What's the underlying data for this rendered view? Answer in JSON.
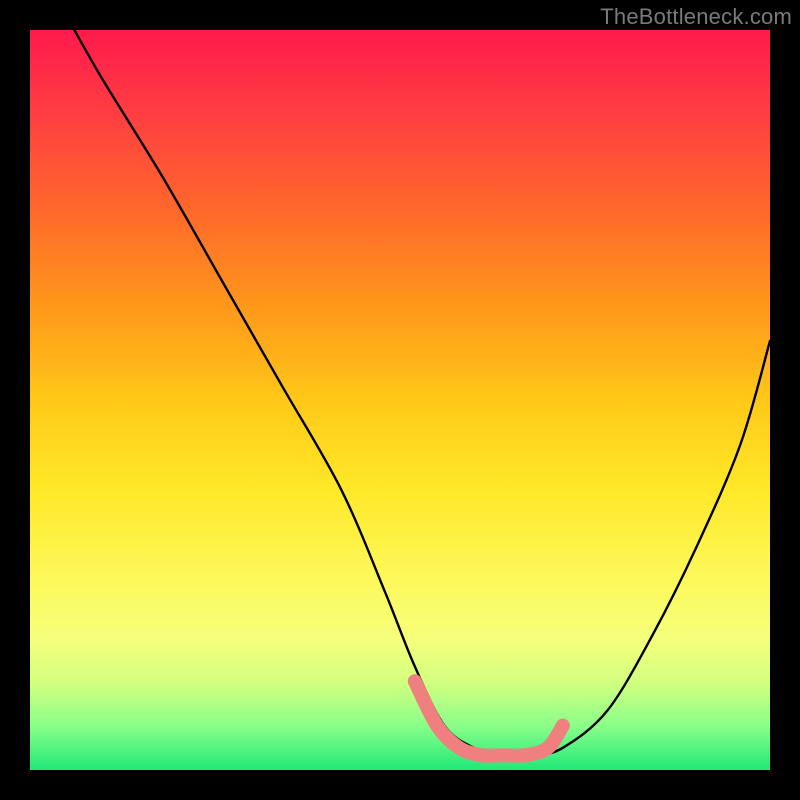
{
  "watermark": "TheBottleneck.com",
  "chart_data": {
    "type": "line",
    "title": "",
    "xlabel": "",
    "ylabel": "",
    "xlim": [
      0,
      100
    ],
    "ylim": [
      0,
      100
    ],
    "series": [
      {
        "name": "curve",
        "color": "#000000",
        "x": [
          6,
          10,
          18,
          26,
          34,
          42,
          48,
          52,
          56,
          60,
          64,
          68,
          72,
          78,
          84,
          90,
          96,
          100
        ],
        "values": [
          100,
          93,
          80,
          66,
          52,
          38,
          24,
          14,
          6,
          3,
          2,
          2,
          3,
          8,
          18,
          30,
          44,
          58
        ]
      },
      {
        "name": "highlight",
        "color": "#f08080",
        "x": [
          52,
          55,
          58,
          61,
          64,
          67,
          70,
          72
        ],
        "values": [
          12,
          6,
          3,
          2,
          2,
          2,
          3,
          6
        ]
      }
    ]
  }
}
